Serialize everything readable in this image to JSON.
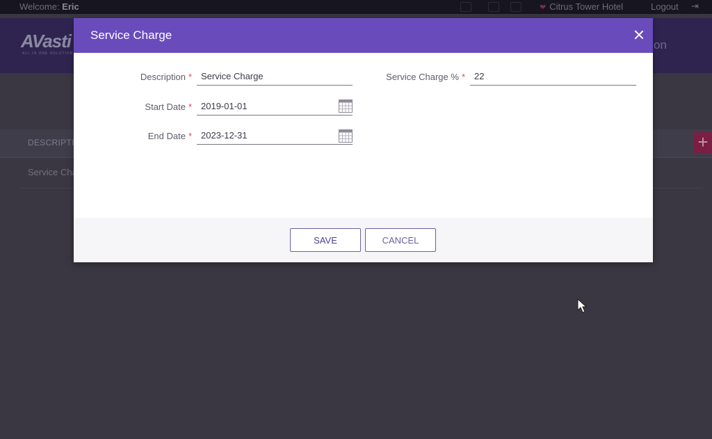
{
  "topbar": {
    "welcome_prefix": "Welcome: ",
    "user_name": "Eric",
    "hotel_name": "Citrus Tower Hotel",
    "logout_label": "Logout"
  },
  "header": {
    "logo_text": "AVasti",
    "logo_subtitle": "ALL IN ONE SOLUTION",
    "right_text": "on"
  },
  "table": {
    "column_description": "DESCRIPTIO",
    "row_description": "Service Cha",
    "add_symbol": "+"
  },
  "modal": {
    "title": "Service Charge",
    "fields": {
      "description": {
        "label": "Description",
        "value": "Service Charge"
      },
      "start_date": {
        "label": "Start Date",
        "value": "2019-01-01"
      },
      "end_date": {
        "label": "End Date",
        "value": "2023-12-31"
      },
      "service_charge_pct": {
        "label": "Service Charge %",
        "value": "22"
      }
    },
    "required_marker": "*",
    "save_label": "SAVE",
    "cancel_label": "CANCEL"
  },
  "colors": {
    "accent": "#6a4bbb",
    "required": "#e0475c",
    "overlay_bg": "#3a3742"
  },
  "icons": [
    "close-icon",
    "calendar-icon",
    "heart-icon",
    "logout-icon",
    "plus-icon",
    "mouse-pointer-icon"
  ]
}
